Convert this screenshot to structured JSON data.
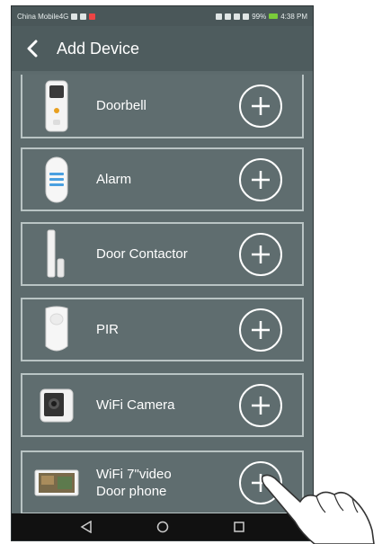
{
  "status_bar": {
    "carrier": "China Mobile4G",
    "right_text": "99%",
    "time": "4:38 PM"
  },
  "header": {
    "title": "Add Device",
    "back_icon": "chevron-left-icon"
  },
  "devices": [
    {
      "label": "Doorbell",
      "image": "doorbell-icon"
    },
    {
      "label": "Alarm",
      "image": "alarm-siren-icon"
    },
    {
      "label": "Door Contactor",
      "image": "door-contact-sensor-icon"
    },
    {
      "label": "PIR",
      "image": "pir-motion-sensor-icon"
    },
    {
      "label": "WiFi Camera",
      "image": "wifi-camera-icon"
    },
    {
      "label_line1": "WiFi 7\"video",
      "label_line2": "Door phone",
      "image": "video-door-phone-icon"
    }
  ],
  "add_icon": "plus-circle-icon",
  "nav_bar": {
    "buttons": [
      "back-triangle-icon",
      "home-circle-icon",
      "recents-square-icon"
    ]
  },
  "colors": {
    "screen_bg": "#5d6b6d",
    "header_bg": "#4e5c5e",
    "row_border": "#b9c4c4",
    "nav_bg": "#111111"
  }
}
